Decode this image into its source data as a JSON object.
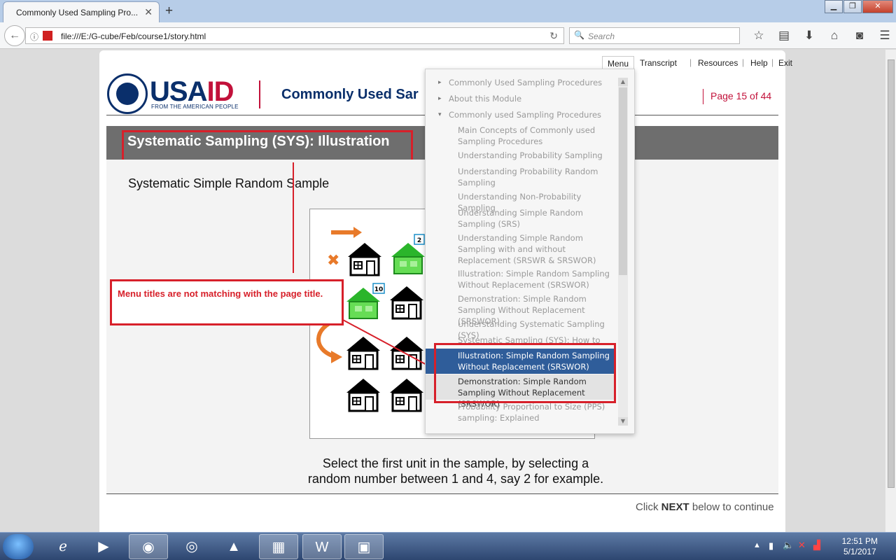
{
  "browser": {
    "tab_title": "Commonly Used Sampling Pro...",
    "tab_close": "✕",
    "new_tab": "+",
    "url": "file:///E:/G-cube/Feb/course1/story.html",
    "search_placeholder": "Search"
  },
  "player": {
    "logo_text_blue": "USA",
    "logo_text_red": "ID",
    "logo_subtitle": "FROM THE AMERICAN PEOPLE",
    "course_title": "Commonly Used Sar",
    "page_counter": "Page 15 of  44",
    "nav": {
      "menu": "Menu",
      "transcript": "Transcript",
      "resources": "Resources",
      "help": "Help",
      "exit": "Exit",
      "sep": "|"
    },
    "slide_heading": "Systematic Sampling (SYS): Illustration",
    "subtitle": "Systematic Simple Random Sample",
    "caption_line1": "Select the first unit in the sample, by selecting a",
    "caption_line2": "random number between 1 and 4, say 2 for example.",
    "footer_prefix": "Click ",
    "footer_bold": "NEXT",
    "footer_suffix": " below to continue"
  },
  "illustration": {
    "badge_a": "2",
    "badge_b": "10"
  },
  "callout": {
    "text": "Menu titles are not matching with the page title."
  },
  "menu": {
    "items": [
      {
        "label": "Commonly Used Sampling Procedures",
        "level": "top",
        "caret": "▸"
      },
      {
        "label": "About this Module",
        "level": "top",
        "caret": "▸"
      },
      {
        "label": "Commonly used Sampling Procedures",
        "level": "top",
        "caret": "▾"
      },
      {
        "label": "Main Concepts of Commonly used Sampling Procedures",
        "level": "sub"
      },
      {
        "label": "Understanding Probability Sampling",
        "level": "sub"
      },
      {
        "label": "Understanding Probability Random Sampling",
        "level": "sub"
      },
      {
        "label": "Understanding Non-Probability Sampling",
        "level": "sub"
      },
      {
        "label": "Understanding Simple Random Sampling (SRS)",
        "level": "sub"
      },
      {
        "label": "Understanding Simple Random Sampling with and without Replacement (SRSWR & SRSWOR)",
        "level": "sub"
      },
      {
        "label": "Illustration: Simple Random Sampling Without Replacement (SRSWOR)",
        "level": "sub"
      },
      {
        "label": "Demonstration: Simple Random Sampling Without Replacement (SRSWOR)",
        "level": "sub"
      },
      {
        "label": "Understanding Systematic Sampling (SYS)",
        "level": "sub"
      },
      {
        "label": "Systematic Sampling (SYS): How to Apply",
        "level": "sub"
      },
      {
        "label": "Illustration: Simple Random Sampling Without Replacement (SRSWOR)",
        "level": "sub",
        "state": "selected"
      },
      {
        "label": "Demonstration: Simple Random Sampling Without Replacement (SRSWOR)",
        "level": "sub",
        "state": "hover"
      },
      {
        "label": "Probability Proportional to Size (PPS) sampling: Explained",
        "level": "sub"
      }
    ],
    "scroll_up": "▲",
    "scroll_down": "▼"
  },
  "taskbar": {
    "time": "12:51 PM",
    "date": "5/1/2017"
  },
  "colors": {
    "brand_blue": "#0a2f6b",
    "brand_red": "#c2113a",
    "annotation_red": "#d7202a",
    "menu_selected": "#2f5d9a"
  }
}
